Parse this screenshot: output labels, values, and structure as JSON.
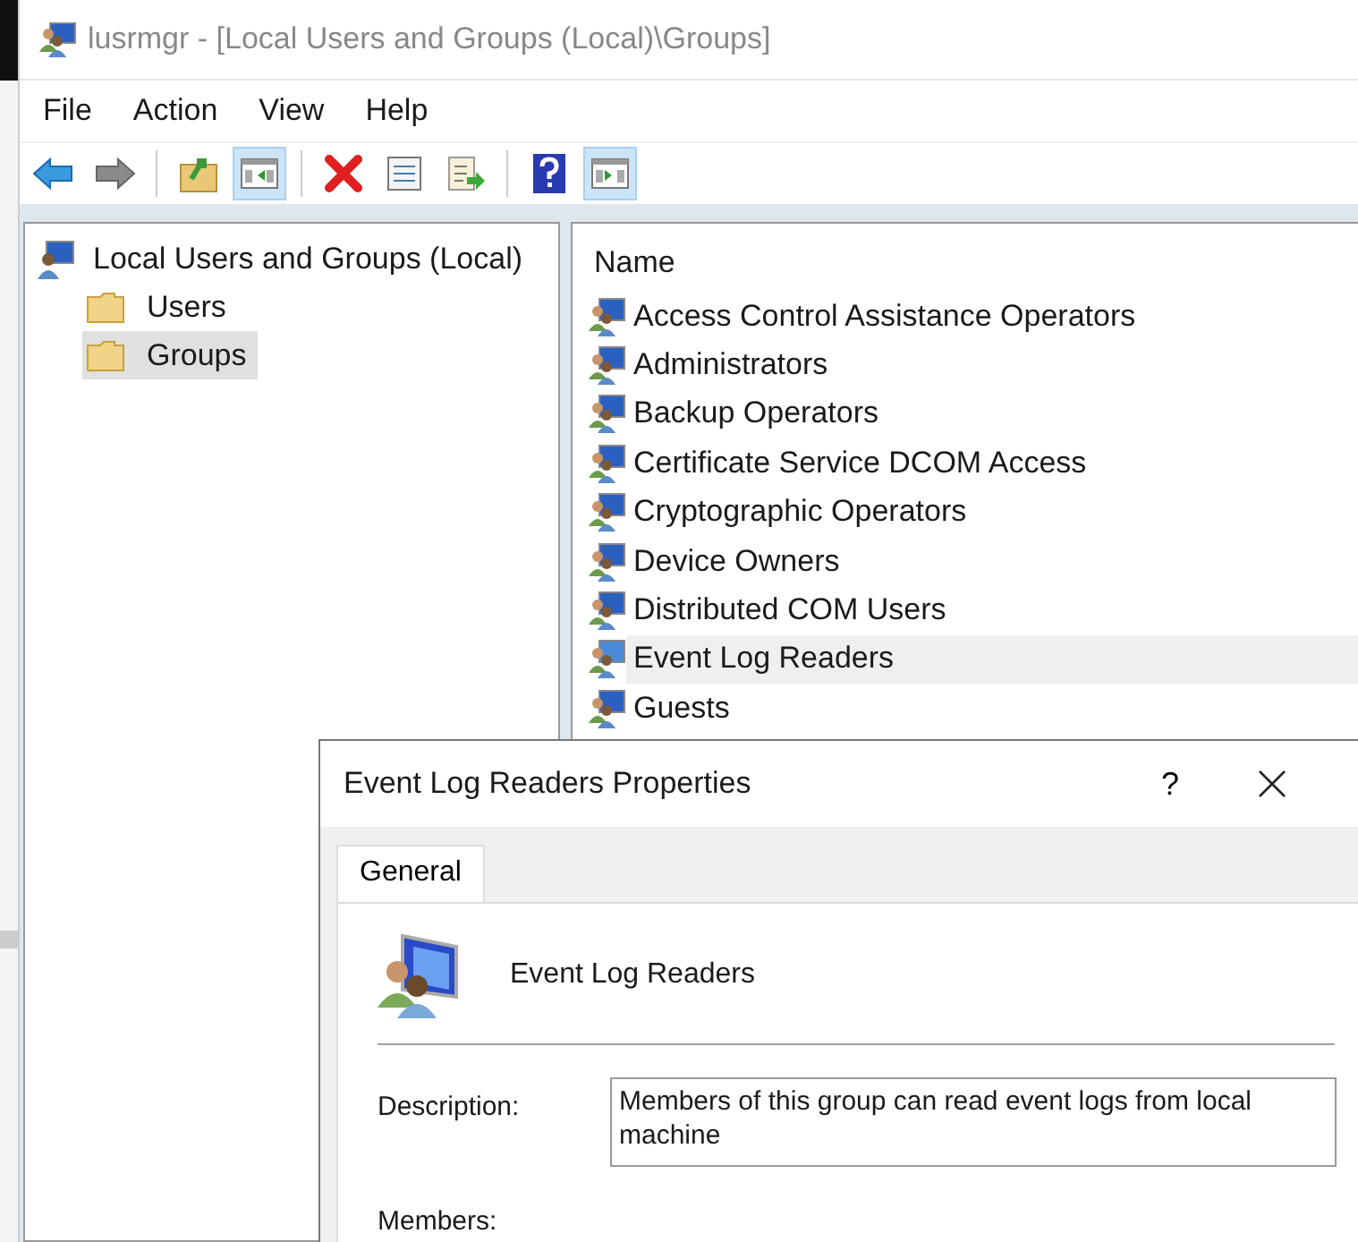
{
  "window": {
    "title": "lusrmgr - [Local Users and Groups (Local)\\Groups]"
  },
  "menu": [
    "File",
    "Action",
    "View",
    "Help"
  ],
  "toolbar": [
    {
      "kind": "back",
      "pressed": false
    },
    {
      "kind": "forward",
      "pressed": false
    },
    {
      "kind": "up",
      "pressed": false
    },
    {
      "kind": "tree",
      "pressed": true
    },
    {
      "kind": "delete",
      "pressed": false
    },
    {
      "kind": "properties",
      "pressed": false
    },
    {
      "kind": "export",
      "pressed": false
    },
    {
      "kind": "help",
      "pressed": false
    },
    {
      "kind": "actionpane",
      "pressed": true
    }
  ],
  "tree": {
    "label": "Local Users and Groups (Local)",
    "children": [
      {
        "label": "Users",
        "selected": false
      },
      {
        "label": "Groups",
        "selected": true
      }
    ]
  },
  "list": {
    "columns": [
      "Name"
    ],
    "rows": [
      {
        "name": "Access Control Assistance Operators",
        "selected": false
      },
      {
        "name": "Administrators",
        "selected": false
      },
      {
        "name": "Backup Operators",
        "selected": false
      },
      {
        "name": "Certificate Service DCOM Access",
        "selected": false
      },
      {
        "name": "Cryptographic Operators",
        "selected": false
      },
      {
        "name": "Device Owners",
        "selected": false
      },
      {
        "name": "Distributed COM Users",
        "selected": false
      },
      {
        "name": "Event Log Readers",
        "selected": true
      },
      {
        "name": "Guests",
        "selected": false
      }
    ]
  },
  "dialog": {
    "title": "Event Log Readers Properties",
    "help": "?",
    "tabs": [
      {
        "label": "General",
        "selected": true
      }
    ],
    "group_name": "Event Log Readers",
    "description_label": "Description:",
    "description": "Members of this group can read event logs from local machine",
    "members_label": "Members:"
  }
}
